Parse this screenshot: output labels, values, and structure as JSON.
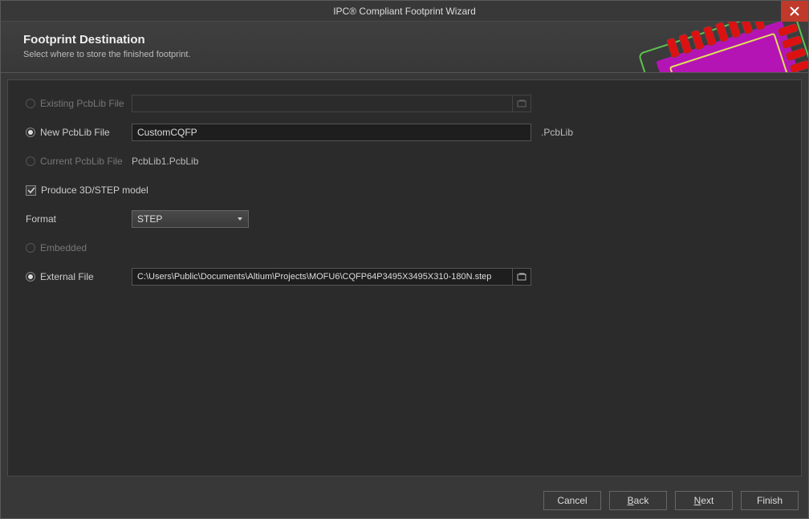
{
  "window": {
    "title": "IPC® Compliant Footprint Wizard"
  },
  "header": {
    "title": "Footprint Destination",
    "subtitle": "Select where to store the finished footprint."
  },
  "dest": {
    "existing": {
      "label": "Existing PcbLib File",
      "value": "",
      "selected": false,
      "enabled": false
    },
    "new": {
      "label": "New PcbLib File",
      "value": "CustomCQFP",
      "suffix": ".PcbLib",
      "selected": true
    },
    "current": {
      "label": "Current PcbLib File",
      "value": "PcbLib1.PcbLib",
      "selected": false,
      "enabled": false
    }
  },
  "produce3d": {
    "label": "Produce 3D/STEP model",
    "checked": true
  },
  "format": {
    "label": "Format",
    "value": "STEP"
  },
  "model": {
    "embedded": {
      "label": "Embedded",
      "selected": false,
      "enabled": false
    },
    "external": {
      "label": "External File",
      "selected": true,
      "path": "C:\\Users\\Public\\Documents\\Altium\\Projects\\MOFU6\\CQFP64P3495X3495X310-180N.step"
    }
  },
  "footer": {
    "cancel": "Cancel",
    "back": {
      "pre": "",
      "ul": "B",
      "post": "ack"
    },
    "next": {
      "pre": "",
      "ul": "N",
      "post": "ext"
    },
    "finish": "Finish"
  }
}
